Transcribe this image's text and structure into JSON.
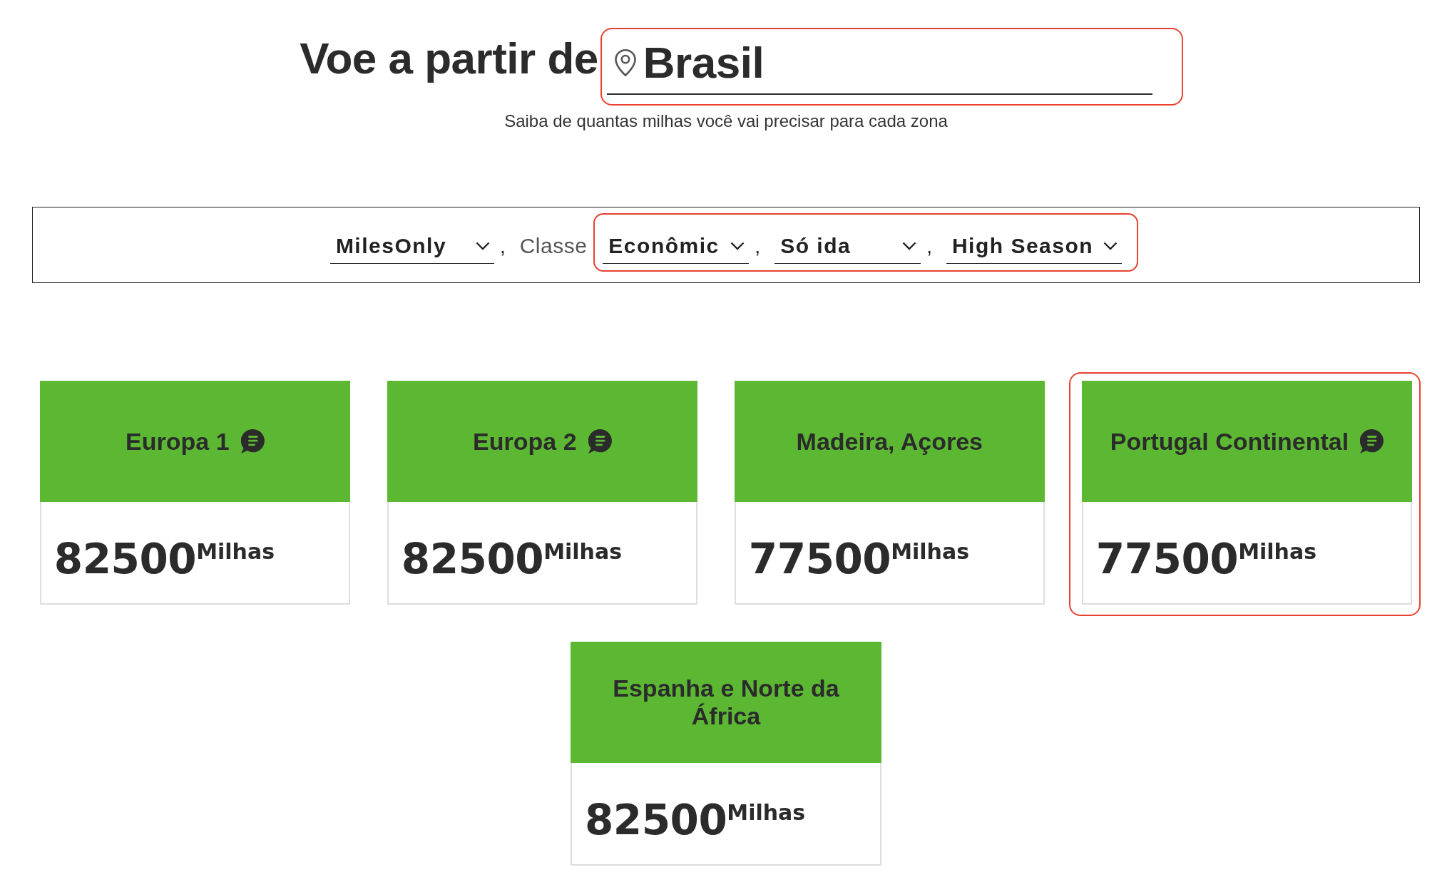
{
  "header": {
    "title": "Voe a partir de",
    "location": {
      "value": "Brasil",
      "highlighted": true
    },
    "subtitle": "Saiba de quantas milhas você vai precisar para cada zona"
  },
  "filters": [
    {
      "highlighted": false,
      "items": [
        {
          "kind": "dropdown",
          "value": "MilesOnly"
        },
        {
          "kind": "separator",
          "text": ","
        },
        {
          "kind": "label",
          "text": "Classe"
        }
      ]
    },
    {
      "highlighted": true,
      "items": [
        {
          "kind": "dropdown",
          "value": "Econômic"
        },
        {
          "kind": "separator",
          "text": ","
        },
        {
          "kind": "dropdown",
          "value": "Só ida"
        },
        {
          "kind": "separator",
          "text": ","
        },
        {
          "kind": "dropdown",
          "value": "High Season"
        }
      ]
    }
  ],
  "zones": [
    {
      "name": "Europa 1",
      "info_icon": true,
      "miles": "82500",
      "unit": "Milhas",
      "highlighted": false
    },
    {
      "name": "Europa 2",
      "info_icon": true,
      "miles": "82500",
      "unit": "Milhas",
      "highlighted": false
    },
    {
      "name": "Madeira, Açores",
      "info_icon": false,
      "miles": "77500",
      "unit": "Milhas",
      "highlighted": false
    },
    {
      "name": "Portugal Continental",
      "info_icon": true,
      "miles": "77500",
      "unit": "Milhas",
      "highlighted": true
    },
    {
      "name": "Espanha e Norte da África",
      "info_icon": false,
      "miles": "82500",
      "unit": "Milhas",
      "highlighted": false
    }
  ]
}
